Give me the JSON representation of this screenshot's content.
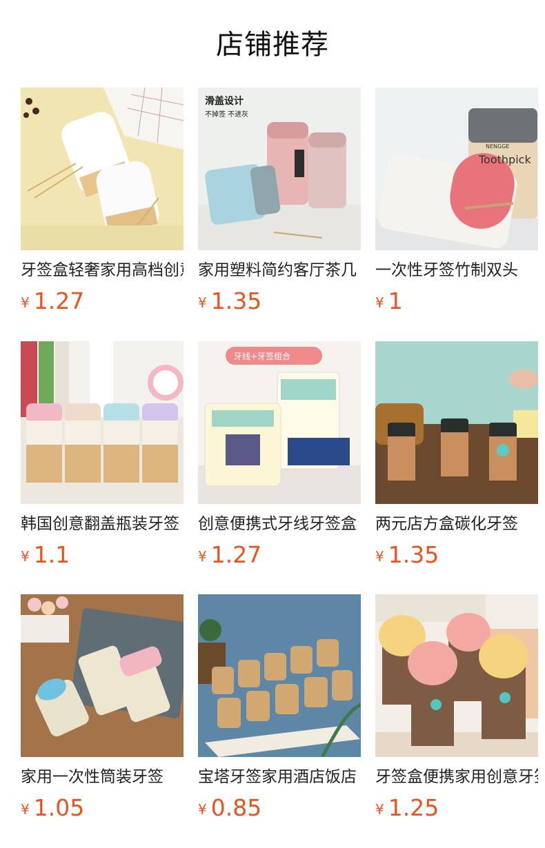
{
  "page": {
    "title": "店铺推荐"
  },
  "products": [
    {
      "name": "牙签盒轻奢家用高档创意",
      "currency": "¥",
      "price": "1.27",
      "image": "white-ribbed-toothpick-holders"
    },
    {
      "name": "家用塑料简约客厅茶几",
      "currency": "¥",
      "price": "1.35",
      "image": "pastel-sliding-lid-holders",
      "badge": "滑盖设计",
      "badge_sub": "不掉签  不进灰"
    },
    {
      "name": "一次性牙签竹制双头",
      "currency": "¥",
      "price": "1",
      "image": "pink-cap-toothpick-bottles",
      "label_text": "Toothpick",
      "brand_text": "NENGGE"
    },
    {
      "name": "韩国创意翻盖瓶装牙签",
      "currency": "¥",
      "price": "1.1",
      "image": "pastel-flip-cap-bottles"
    },
    {
      "name": "创意便携式牙线牙签盒",
      "currency": "¥",
      "price": "1.27",
      "image": "floss-toothpick-combo-box",
      "badge": "牙线+牙签组合"
    },
    {
      "name": "两元店方盒碳化牙签",
      "currency": "¥",
      "price": "1.35",
      "image": "square-carbonized-toothpick-boxes"
    },
    {
      "name": "家用一次性筒装牙签",
      "currency": "¥",
      "price": "1.05",
      "image": "tube-toothpick-bottles"
    },
    {
      "name": "宝塔牙签家用酒店饭店",
      "currency": "¥",
      "price": "0.85",
      "image": "tray-of-pagoda-toothpick-jars"
    },
    {
      "name": "牙签盒便携家用创意牙签",
      "currency": "¥",
      "price": "1.25",
      "image": "pink-yellow-dome-holders"
    }
  ]
}
